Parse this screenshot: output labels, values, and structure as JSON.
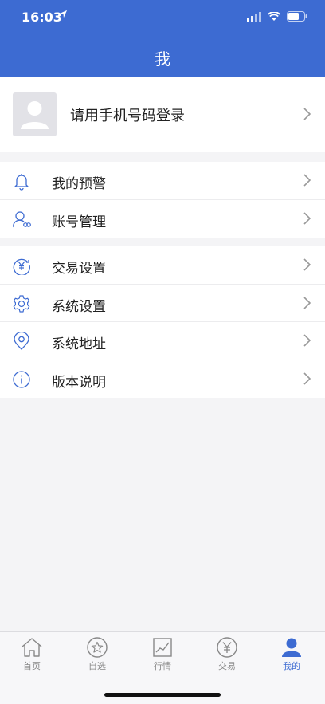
{
  "status": {
    "time": "16:03"
  },
  "nav": {
    "title": "我"
  },
  "login": {
    "prompt": "请用手机号码登录"
  },
  "groups": [
    {
      "items": [
        {
          "label": "我的预警",
          "icon": "bell-icon"
        },
        {
          "label": "账号管理",
          "icon": "account-icon"
        }
      ]
    },
    {
      "items": [
        {
          "label": "交易设置",
          "icon": "yuan-icon"
        },
        {
          "label": "系统设置",
          "icon": "gear-icon"
        },
        {
          "label": "系统地址",
          "icon": "location-pin-icon"
        },
        {
          "label": "版本说明",
          "icon": "info-icon"
        }
      ]
    }
  ],
  "tabs": [
    {
      "label": "首页",
      "icon": "home-icon"
    },
    {
      "label": "自选",
      "icon": "star-icon"
    },
    {
      "label": "行情",
      "icon": "chart-icon"
    },
    {
      "label": "交易",
      "icon": "yuan-icon"
    },
    {
      "label": "我的",
      "icon": "person-icon",
      "active": true
    }
  ],
  "colors": {
    "brand": "#3d6bd2",
    "inactive_tab": "#888888",
    "icon_line": "#3d6bd2"
  }
}
